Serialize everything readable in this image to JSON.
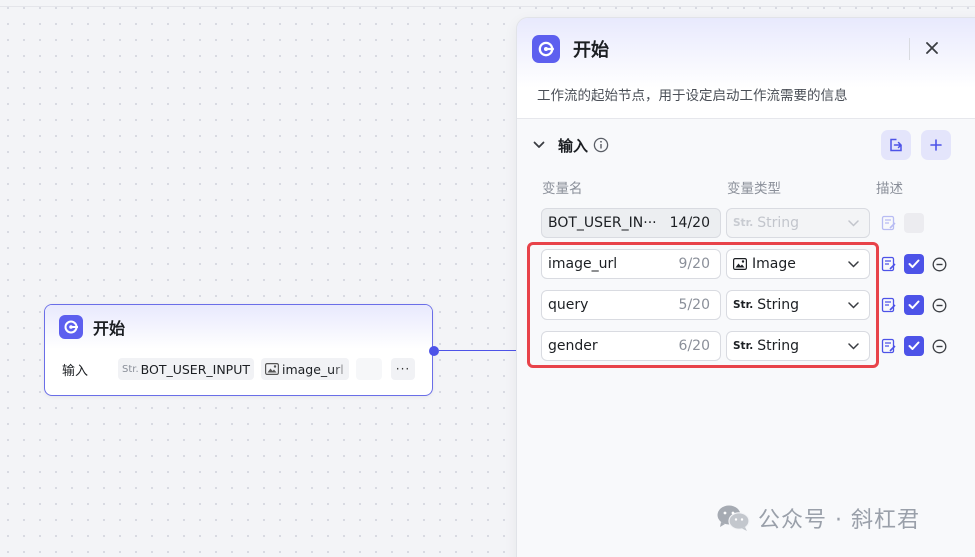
{
  "node": {
    "title": "开始",
    "input_label": "输入",
    "chips": [
      {
        "prefix": "Str.",
        "label": "BOT_USER_INPUT"
      },
      {
        "icon": "image-icon",
        "label": "image_url"
      }
    ],
    "more_label": "···"
  },
  "panel": {
    "title": "开始",
    "description": "工作流的起始节点，用于设定启动工作流需要的信息",
    "section_title": "输入",
    "columns": {
      "name": "变量名",
      "type": "变量类型",
      "desc": "描述"
    },
    "rows": [
      {
        "name": "BOT_USER_IN···",
        "count": "14/20",
        "type_prefix": "Str.",
        "type": "String",
        "disabled": true,
        "required": false
      },
      {
        "name": "image_url",
        "count": "9/20",
        "type_icon": "image-icon",
        "type": "Image",
        "disabled": false,
        "required": true
      },
      {
        "name": "query",
        "count": "5/20",
        "type_prefix": "Str.",
        "type": "String",
        "disabled": false,
        "required": true
      },
      {
        "name": "gender",
        "count": "6/20",
        "type_prefix": "Str.",
        "type": "String",
        "disabled": false,
        "required": true
      }
    ]
  },
  "watermark": "公众号 · 斜杠君",
  "colors": {
    "accent": "#4d53e8",
    "highlight": "#e8434a",
    "node_icon_bg": "#5d5fef"
  }
}
